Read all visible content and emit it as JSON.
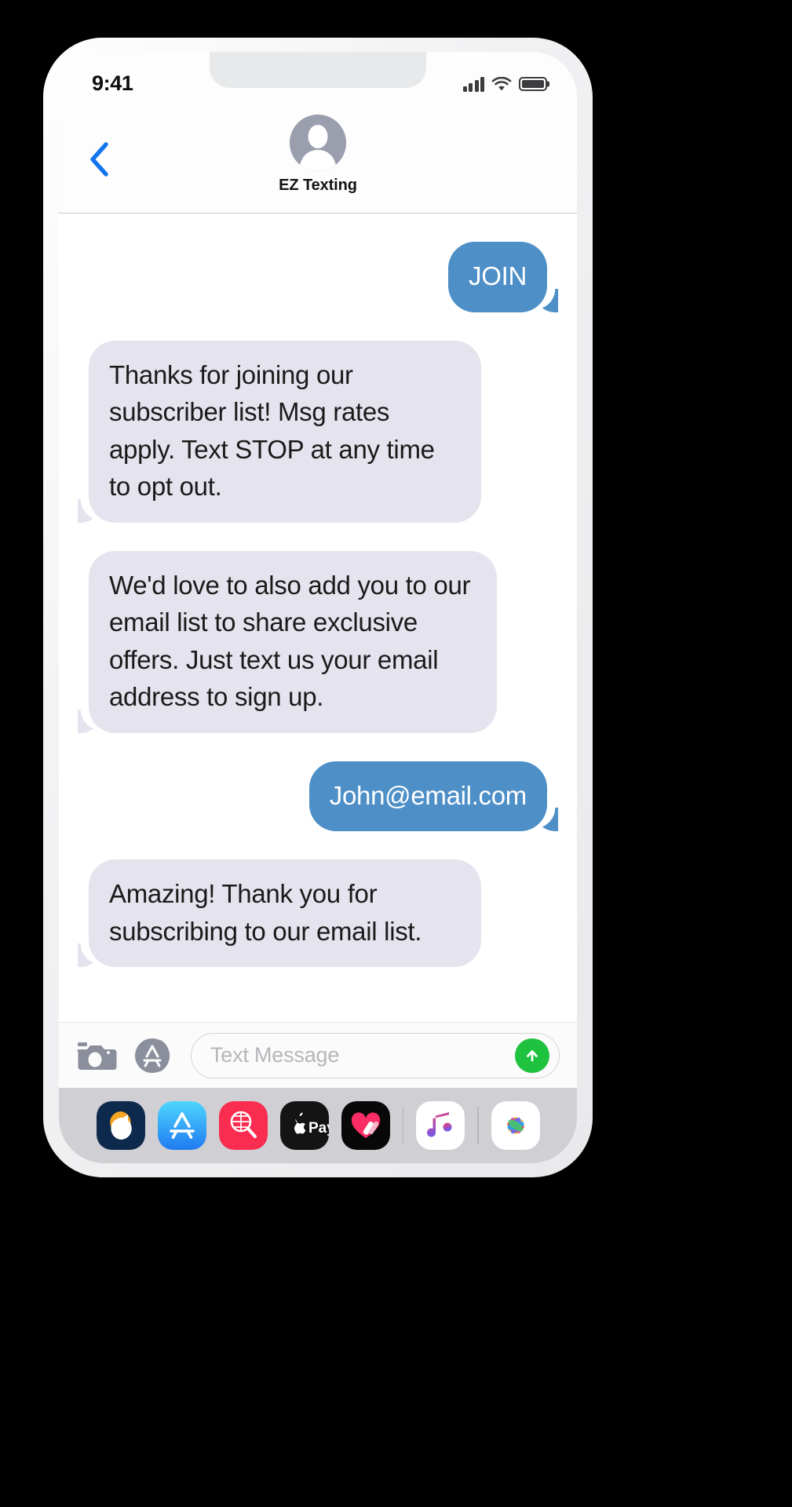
{
  "device": {
    "type": "iphone",
    "shell_color": "#f2f2f3"
  },
  "status_bar": {
    "time": "9:41",
    "signal_icon": "cellular-signal-icon",
    "signal_bars": 4,
    "wifi_icon": "wifi-icon",
    "battery_icon": "battery-full-icon",
    "battery_level": 100
  },
  "nav_bar": {
    "back_icon": "chevron-left-icon",
    "back_color": "#1274ef",
    "avatar_icon": "contact-avatar-icon",
    "contact_name": "EZ Texting"
  },
  "conversation": {
    "outgoing_color": "#4e8fc7",
    "incoming_color": "#e5e3ed",
    "outgoing_text_color": "#ffffff",
    "incoming_text_color": "#1a1a1a",
    "messages": [
      {
        "direction": "outgoing",
        "text": "JOIN"
      },
      {
        "direction": "incoming",
        "text": "Thanks for joining our subscriber list! Msg rates apply. Text STOP at any time to opt out."
      },
      {
        "direction": "incoming",
        "text": "We'd love to also add you to our email list to share exclusive offers. Just text us your email address to sign up."
      },
      {
        "direction": "outgoing",
        "text": "John@email.com"
      },
      {
        "direction": "incoming",
        "text": "Amazing! Thank you for subscribing to our email list."
      }
    ]
  },
  "input_bar": {
    "camera_icon": "camera-icon",
    "appstore_icon": "imessage-app-store-icon",
    "placeholder": "Text Message",
    "value": "",
    "send_icon": "send-arrow-up-icon",
    "send_color": "#1fc23f"
  },
  "app_dock": {
    "apps": [
      {
        "name": "handoff-app-icon",
        "label": "Handoff"
      },
      {
        "name": "app-store-icon",
        "label": "App Store"
      },
      {
        "name": "photo-search-icon",
        "label": "#images"
      },
      {
        "name": "apple-pay-icon",
        "label": "Apple Pay"
      },
      {
        "name": "digital-touch-icon",
        "label": "Digital Touch"
      },
      {
        "name": "apple-music-icon",
        "label": "Music"
      },
      {
        "name": "photos-icon",
        "label": "Photos"
      }
    ]
  }
}
